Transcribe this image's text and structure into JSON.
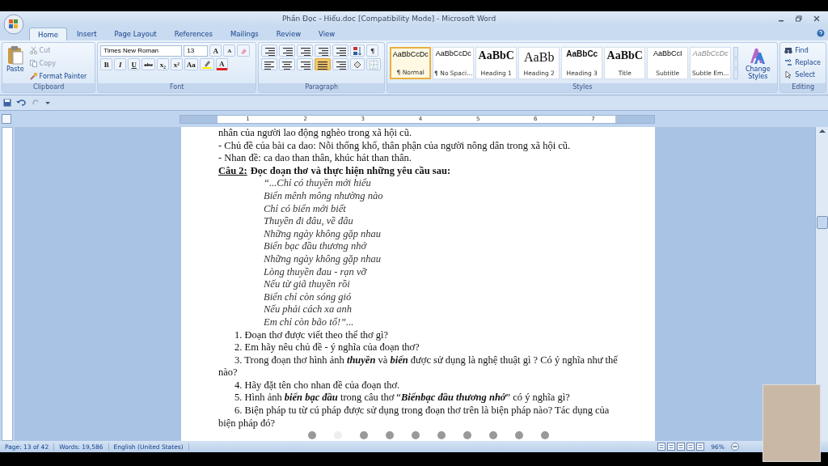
{
  "window": {
    "title": "Phần Đọc - Hiểu.doc [Compatibility Mode] - Microsoft Word"
  },
  "tabs": [
    {
      "label": "Home",
      "selected": true
    },
    {
      "label": "Insert",
      "selected": false
    },
    {
      "label": "Page Layout",
      "selected": false
    },
    {
      "label": "References",
      "selected": false
    },
    {
      "label": "Mailings",
      "selected": false
    },
    {
      "label": "Review",
      "selected": false
    },
    {
      "label": "View",
      "selected": false
    }
  ],
  "clipboard": {
    "paste": "Paste",
    "cut": "Cut",
    "copy": "Copy",
    "format_painter": "Format Painter",
    "label": "Clipboard"
  },
  "font": {
    "family": "Times New Roman",
    "size": "13",
    "grow": "A",
    "shrink": "A",
    "buttons": [
      "B",
      "I",
      "U",
      "abc",
      "x₂",
      "x²",
      "Aa"
    ],
    "color_letter": "A",
    "label": "Font"
  },
  "paragraph": {
    "pilcrow": "¶",
    "label": "Paragraph"
  },
  "styles": {
    "items": [
      {
        "sample": "AaBbCcDc",
        "name": "¶ Normal",
        "kind": "plain",
        "selected": true
      },
      {
        "sample": "AaBbCcDc",
        "name": "¶ No Spaci...",
        "kind": "plain",
        "selected": false
      },
      {
        "sample": "AaBbC",
        "name": "Heading 1",
        "kind": "heading",
        "selected": false
      },
      {
        "sample": "AaBb",
        "name": "Heading 2",
        "kind": "big",
        "selected": false
      },
      {
        "sample": "AaBbCc",
        "name": "Heading 3",
        "kind": "heading3",
        "selected": false
      },
      {
        "sample": "AaBbC",
        "name": "Title",
        "kind": "heading",
        "selected": false
      },
      {
        "sample": "AaBbCcI",
        "name": "Subtitle",
        "kind": "plain",
        "selected": false
      },
      {
        "sample": "AaBbCcDc",
        "name": "Subtle Em...",
        "kind": "subtle",
        "selected": false
      }
    ],
    "change_styles": "Change Styles",
    "label": "Styles"
  },
  "editing": {
    "items": [
      "Find",
      "Replace",
      "Select"
    ],
    "label": "Editing"
  },
  "ruler": {
    "marks": [
      "1",
      "2",
      "3",
      "4",
      "5",
      "6",
      "7"
    ]
  },
  "document": [
    {
      "kind": "body",
      "text": "nhân của người lao động nghèo trong xã hội cũ."
    },
    {
      "kind": "body",
      "text": "- Chủ đề của bài ca dao: Nỗi thống khổ, thân phận của người nông dân trong xã hội cũ."
    },
    {
      "kind": "body",
      "text": "- Nhan đề: ca dao than thân, khúc hát than thân."
    },
    {
      "kind": "heading",
      "label": "Câu 2:",
      "text": "Đọc đoạn thơ và thực hiện những yêu cầu sau:"
    },
    {
      "kind": "poem",
      "text": "“...Chỉ có thuyền mới hiểu"
    },
    {
      "kind": "poem",
      "text": "Biển mênh mông nhường nào"
    },
    {
      "kind": "poem",
      "text": "Chỉ có biển mới biết"
    },
    {
      "kind": "poem",
      "text": "Thuyền đi đâu, về đâu"
    },
    {
      "kind": "poem",
      "text": "Những ngày không gặp nhau"
    },
    {
      "kind": "poem",
      "text": "Biển bạc đầu thương nhớ"
    },
    {
      "kind": "poem",
      "text": "Những ngày không gặp nhau"
    },
    {
      "kind": "poem",
      "text": "Lòng thuyền đau - rạn vỡ"
    },
    {
      "kind": "poem",
      "text": "Nếu từ giã thuyền rồi"
    },
    {
      "kind": "poem",
      "text": "Biển chỉ còn sóng gió"
    },
    {
      "kind": "poem",
      "text": "Nếu phải cách xa anh"
    },
    {
      "kind": "poem",
      "text": "Em chỉ còn bão tố!”..."
    },
    {
      "kind": "question",
      "text": "1. Đoạn thơ được viết theo thể thơ gì?"
    },
    {
      "kind": "question",
      "text": "2. Em hãy nêu chủ đề - ý nghĩa của đoạn thơ?"
    },
    {
      "kind": "question",
      "text": "3. Trong đoạn thơ hình ảnh **thuyền** và **biển** được sử dụng là nghệ thuật gì ? Có ý nghĩa như thế nào?"
    },
    {
      "kind": "question",
      "text": "4. Hãy đặt tên cho nhan đề của đoạn thơ."
    },
    {
      "kind": "question",
      "text": "5. Hình ảnh **biển bạc đầu** trong câu thơ “**Biểnbạc đầu thương nhớ**” có ý nghĩa gì?"
    },
    {
      "kind": "question",
      "text": "6. Biện pháp tu từ cú pháp được sử dụng trong đoạn thơ trên là biện pháp nào? Tác dụng của biện pháp đó?"
    }
  ],
  "status_bar": {
    "page": "Page: 13 of 42",
    "words": "Words: 19,586",
    "language": "English (United States)",
    "zoom": "96%"
  }
}
